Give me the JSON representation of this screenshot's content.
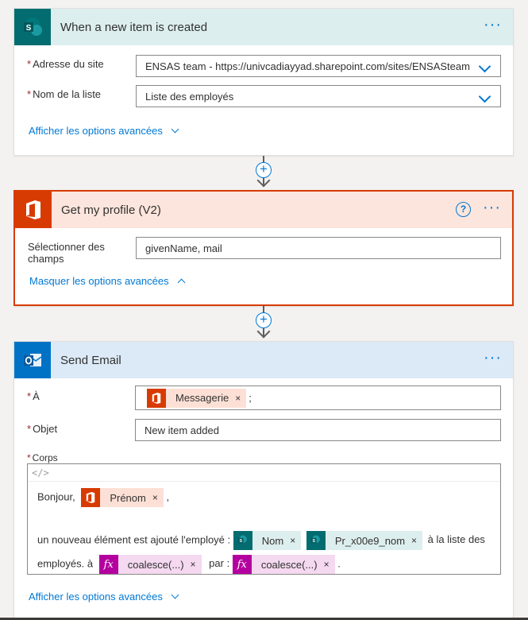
{
  "trigger": {
    "title": "When a new item is created",
    "more": "···",
    "fields": [
      {
        "required": "*",
        "label": "Adresse du site",
        "value": "ENSAS team - https://univcadiayyad.sharepoint.com/sites/ENSASteam"
      },
      {
        "required": "*",
        "label": "Nom de la liste",
        "value": "Liste des employés"
      }
    ],
    "advanced_link": "Afficher les options avancées"
  },
  "connector": {
    "plus": "+"
  },
  "profile": {
    "title": "Get my profile (V2)",
    "help": "?",
    "more": "···",
    "field_label_line1": "Sélectionner des",
    "field_label_line2": "champs",
    "field_value": "givenName, mail",
    "advanced_link": "Masquer les options avancées"
  },
  "email": {
    "title": "Send Email",
    "more": "···",
    "to_required": "*",
    "to_label": "À",
    "to_token": "Messagerie",
    "to_suffix": ";",
    "subject_required": "*",
    "subject_label": "Objet",
    "subject_value": "New item added",
    "body_required": "*",
    "body_label": "Corps",
    "code_icon": "</>",
    "body_greeting": "Bonjour,",
    "token_prenom": "Prénom",
    "after_prenom": ",",
    "line2_text": "un nouveau élément est ajouté l'employé :",
    "token_nom": "Nom",
    "token_pr_nom": "Pr_x00e9_nom",
    "line2_tail": "à la liste des",
    "line3_text": "employés. à",
    "token_fx1": "coalesce(...)",
    "line3_mid": "par :",
    "token_fx2": "coalesce(...)",
    "line3_end": ".",
    "advanced_link": "Afficher les options avancées",
    "token_remove": "×"
  },
  "colors": {
    "accent": "#0078d4",
    "office": "#d83b01",
    "sharepoint": "#036c70",
    "expression": "#b4009e",
    "trigger_header": "#dceeee",
    "profile_header": "#fce5dc",
    "email_header": "#dceaf7"
  },
  "icons": {
    "trigger": "sharepoint-icon",
    "profile": "office-365-icon",
    "email": "outlook-icon"
  }
}
